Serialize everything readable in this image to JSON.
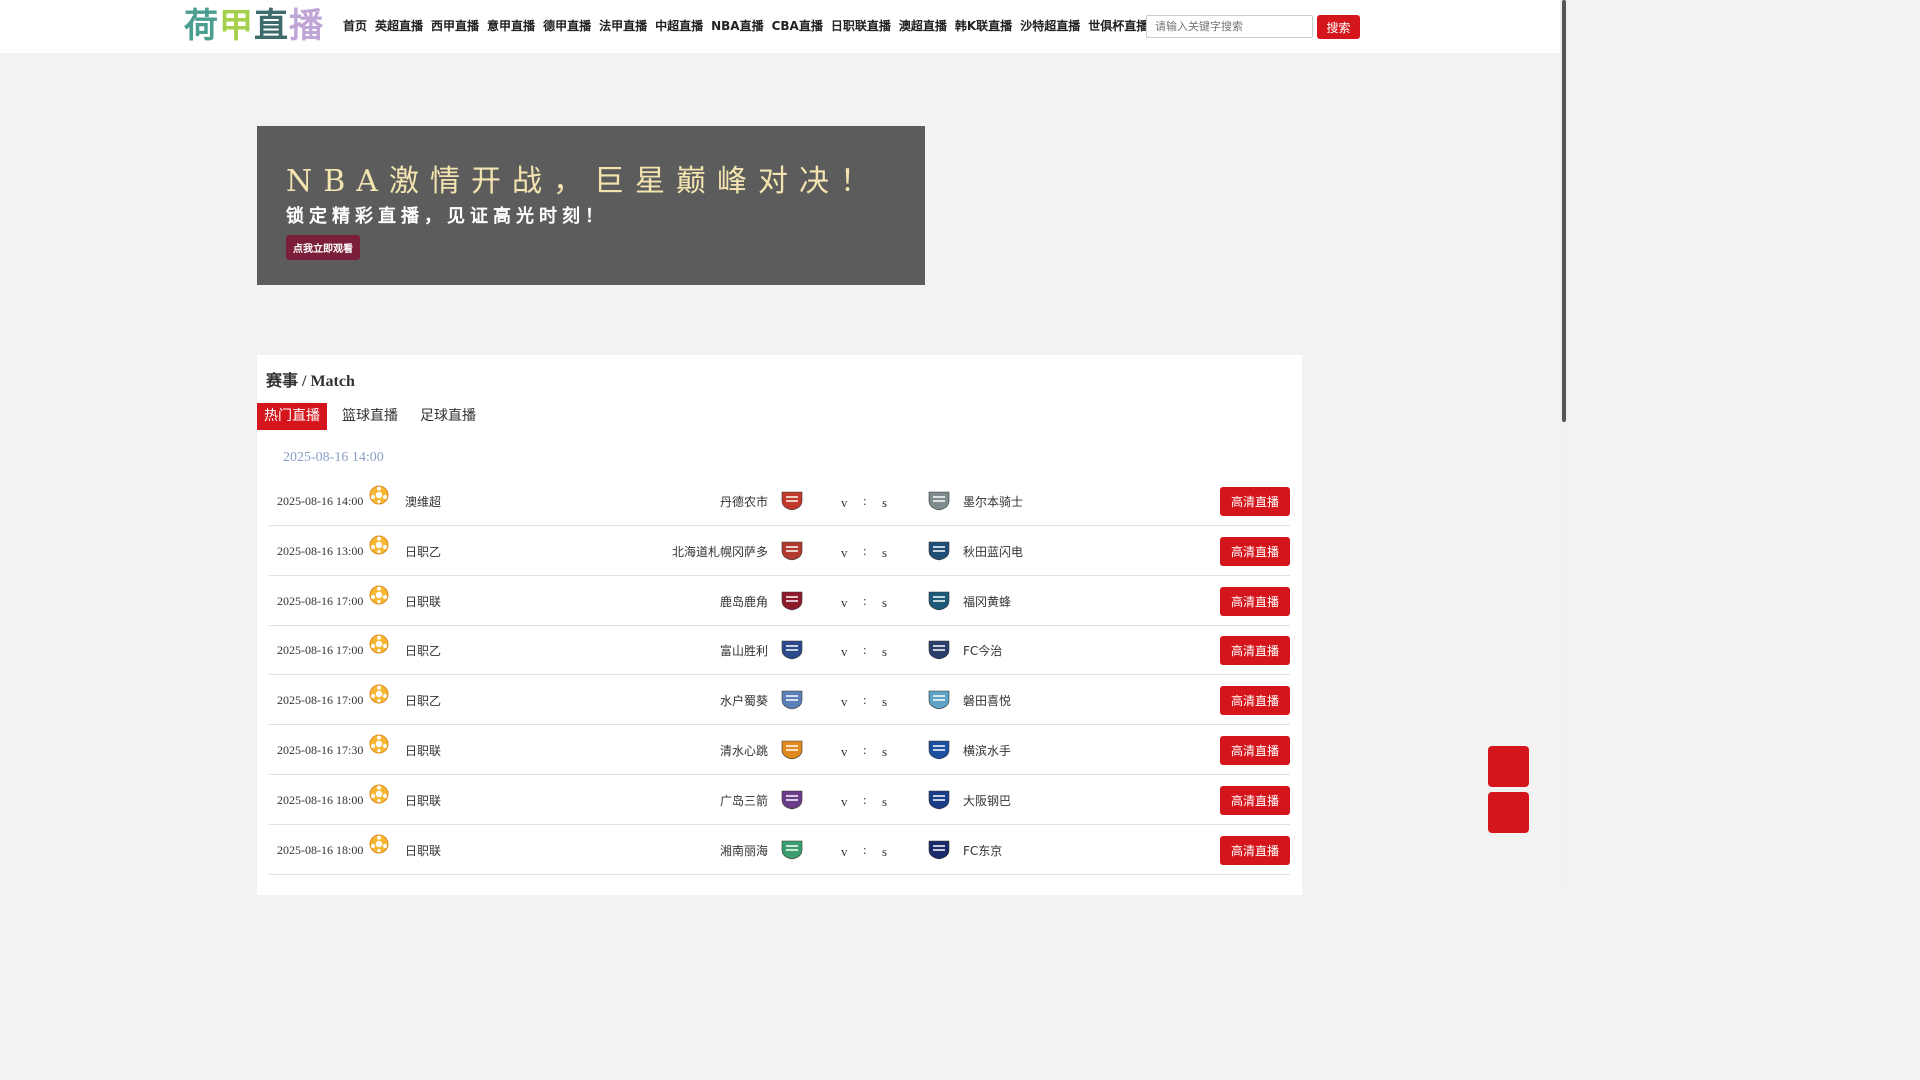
{
  "header": {
    "logo": {
      "chars": [
        "荷",
        "甲",
        "直",
        "播"
      ],
      "colors": [
        "#4a9e8e",
        "#a4cf4a",
        "#3d6a6a",
        "#c0a6d6"
      ]
    },
    "nav": [
      "首页",
      "英超直播",
      "西甲直播",
      "意甲直播",
      "德甲直播",
      "法甲直播",
      "中超直播",
      "NBA直播",
      "CBA直播",
      "日职联直播",
      "澳超直播",
      "韩K联直播",
      "沙特超直播",
      "世俱杯直播"
    ],
    "search": {
      "placeholder": "请输入关键字搜索",
      "button": "搜索"
    }
  },
  "banner": {
    "title": "NBA激情开战，巨星巅峰对决！",
    "subtitle": "锁定精彩直播，见证高光时刻！",
    "button": "点我立即观看"
  },
  "panel": {
    "title": "赛事 / Match",
    "tabs": [
      "热门直播",
      "篮球直播",
      "足球直播"
    ],
    "date_heading": "2025-08-16 14:00",
    "matches": [
      {
        "time": "2025-08-16 14:00",
        "league": "澳维超",
        "home": "丹德农市",
        "vs": "v",
        "colon": ":",
        "s": "s",
        "away": "墨尔本骑士",
        "button": "高清直播",
        "home_color": "#c0392b",
        "away_color": "#7f8c8d"
      },
      {
        "time": "2025-08-16 13:00",
        "league": "日职乙",
        "home": "北海道札幌冈萨多",
        "vs": "v",
        "colon": ":",
        "s": "s",
        "away": "秋田蓝闪电",
        "button": "高清直播",
        "home_color": "#b03a2e",
        "away_color": "#1f4e79"
      },
      {
        "time": "2025-08-16 17:00",
        "league": "日职联",
        "home": "鹿岛鹿角",
        "vs": "v",
        "colon": ":",
        "s": "s",
        "away": "福冈黄蜂",
        "button": "高清直播",
        "home_color": "#8e1b2b",
        "away_color": "#1c5a7a"
      },
      {
        "time": "2025-08-16 17:00",
        "league": "日职乙",
        "home": "富山胜利",
        "vs": "v",
        "colon": ":",
        "s": "s",
        "away": "FC今治",
        "button": "高清直播",
        "home_color": "#2c4a8c",
        "away_color": "#2a3f6b"
      },
      {
        "time": "2025-08-16 17:00",
        "league": "日职乙",
        "home": "水户蜀葵",
        "vs": "v",
        "colon": ":",
        "s": "s",
        "away": "磐田喜悦",
        "button": "高清直播",
        "home_color": "#5b7fb8",
        "away_color": "#5fa3c7"
      },
      {
        "time": "2025-08-16 17:30",
        "league": "日职联",
        "home": "清水心跳",
        "vs": "v",
        "colon": ":",
        "s": "s",
        "away": "横滨水手",
        "button": "高清直播",
        "home_color": "#e08a1e",
        "away_color": "#1d4fa0"
      },
      {
        "time": "2025-08-16 18:00",
        "league": "日职联",
        "home": "广岛三箭",
        "vs": "v",
        "colon": ":",
        "s": "s",
        "away": "大阪钢巴",
        "button": "高清直播",
        "home_color": "#6a3d8a",
        "away_color": "#1a3d8a"
      },
      {
        "time": "2025-08-16 18:00",
        "league": "日职联",
        "home": "湘南丽海",
        "vs": "v",
        "colon": ":",
        "s": "s",
        "away": "FC东京",
        "button": "高清直播",
        "home_color": "#3a9e6e",
        "away_color": "#1a2a6b"
      }
    ]
  },
  "colors": {
    "accent": "#d4161c",
    "ball": "#f5a623"
  }
}
